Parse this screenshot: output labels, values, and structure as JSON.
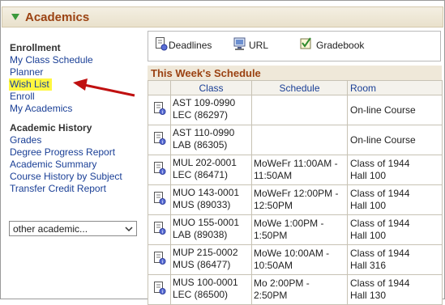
{
  "header": {
    "title": "Academics"
  },
  "nav": {
    "enrollment_heading": "Enrollment",
    "enrollment_links": [
      "My Class Schedule",
      "Planner",
      "Wish List",
      "Enroll",
      "My Academics"
    ],
    "history_heading": "Academic History",
    "history_links": [
      "Grades",
      "Degree Progress Report",
      "Academic Summary",
      "Course History by Subject",
      "Transfer Credit Report"
    ],
    "other_select": "other academic..."
  },
  "toolbar": {
    "deadlines": "Deadlines",
    "url": "URL",
    "gradebook": "Gradebook"
  },
  "schedule": {
    "title": "This Week's Schedule",
    "columns": [
      "Class",
      "Schedule",
      "Room"
    ],
    "rows": [
      {
        "class1": "AST 109-0990",
        "class2": "LEC (86297)",
        "sched1": "",
        "sched2": "",
        "room1": "On-line Course",
        "room2": ""
      },
      {
        "class1": "AST 110-0990",
        "class2": "LAB (86305)",
        "sched1": "",
        "sched2": "",
        "room1": "On-line Course",
        "room2": ""
      },
      {
        "class1": "MUL 202-0001",
        "class2": "LEC (86471)",
        "sched1": "MoWeFr 11:00AM -",
        "sched2": "11:50AM",
        "room1": "Class of 1944",
        "room2": "Hall 100"
      },
      {
        "class1": "MUO 143-0001",
        "class2": "MUS (89033)",
        "sched1": "MoWeFr 12:00PM -",
        "sched2": "12:50PM",
        "room1": "Class of 1944",
        "room2": "Hall 100"
      },
      {
        "class1": "MUO 155-0001",
        "class2": "LAB (89038)",
        "sched1": "MoWe 1:00PM -",
        "sched2": "1:50PM",
        "room1": "Class of 1944",
        "room2": "Hall 100"
      },
      {
        "class1": "MUP 215-0002",
        "class2": "MUS (86477)",
        "sched1": "MoWe 10:00AM -",
        "sched2": "10:50AM",
        "room1": "Class of 1944",
        "room2": "Hall 316"
      },
      {
        "class1": "MUS 100-0001",
        "class2": "LEC (86500)",
        "sched1": "Mo 2:00PM - 2:50PM",
        "sched2": "",
        "room1": "Class of 1944",
        "room2": "Hall 130"
      }
    ]
  },
  "colors": {
    "header_title": "#9b4212",
    "link": "#1a3f96",
    "highlight": "#fff740",
    "arrow": "#c01010"
  }
}
